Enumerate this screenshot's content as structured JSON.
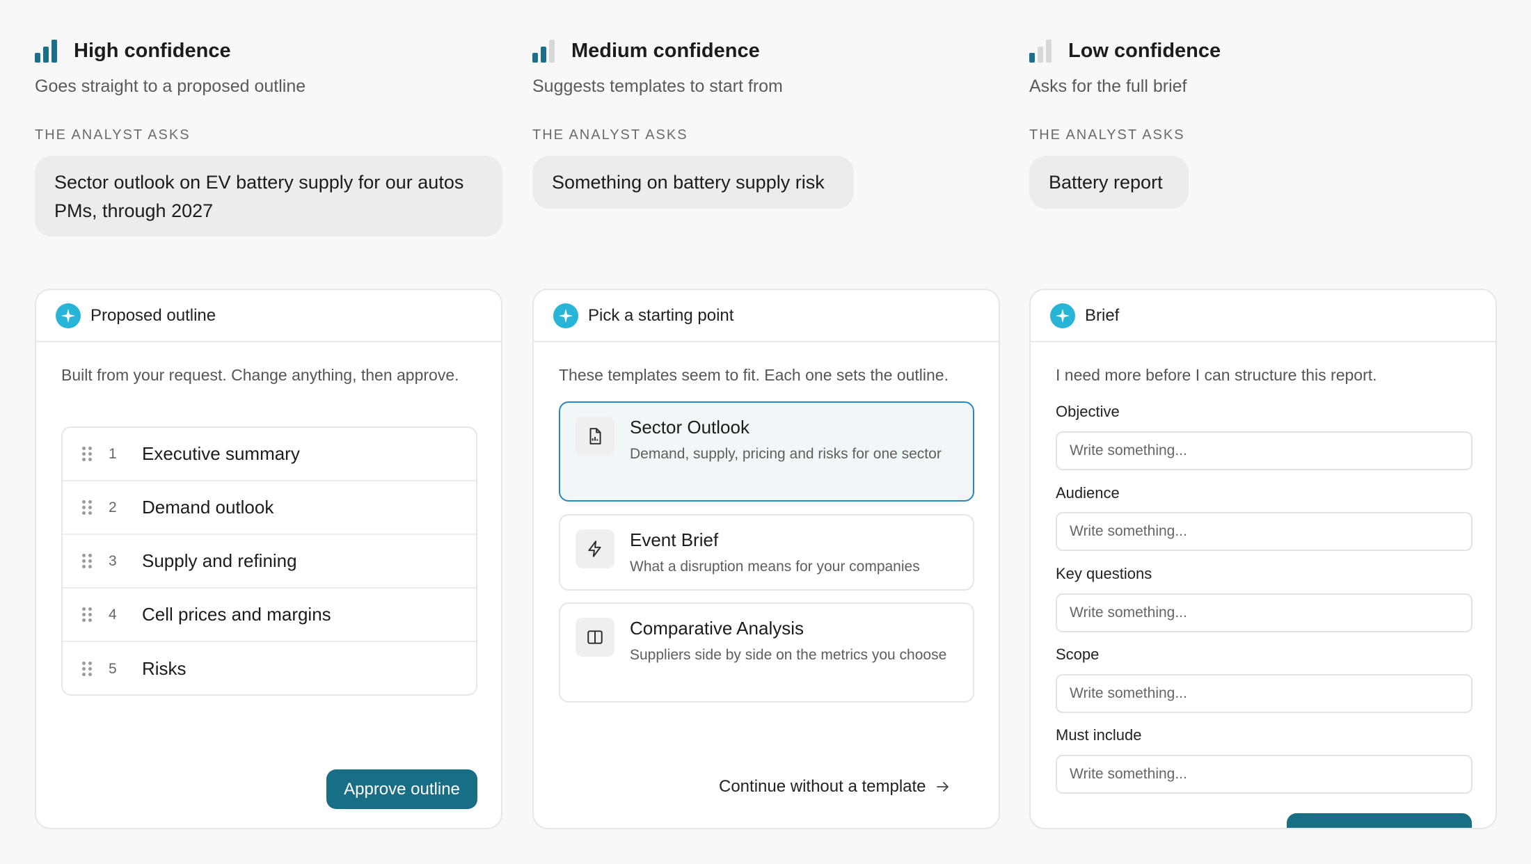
{
  "colors": {
    "accent": "#186f85",
    "bar_on": "#1b6f8a",
    "bar_off": "#d8d8d8",
    "spark": "#27b4d6",
    "selected_border": "#2a86c2"
  },
  "columns": [
    {
      "title": "High confidence",
      "subtitle": "Goes straight to a proposed outline",
      "asks_label": "THE ANALYST ASKS",
      "request": "Sector outlook on EV battery supply for our autos PMs, through 2027",
      "bars_on": 3
    },
    {
      "title": "Medium confidence",
      "subtitle": "Suggests templates to start from",
      "asks_label": "THE ANALYST ASKS",
      "request": "Something on battery supply risk",
      "bars_on": 2
    },
    {
      "title": "Low confidence",
      "subtitle": "Asks for the full brief",
      "asks_label": "THE ANALYST ASKS",
      "request": "Battery report",
      "bars_on": 1
    }
  ],
  "outline_card": {
    "title": "Proposed outline",
    "intro": "Built from your request. Change anything, then approve.",
    "items": [
      {
        "num": "1",
        "label": "Executive summary"
      },
      {
        "num": "2",
        "label": "Demand outlook"
      },
      {
        "num": "3",
        "label": "Supply and refining"
      },
      {
        "num": "4",
        "label": "Cell prices and margins"
      },
      {
        "num": "5",
        "label": "Risks"
      }
    ],
    "approve_label": "Approve outline"
  },
  "template_card": {
    "title": "Pick a starting point",
    "intro": "These templates seem to fit. Each one sets the outline.",
    "templates": [
      {
        "name": "Sector Outlook",
        "desc": "Demand, supply, pricing and risks for one sector",
        "icon": "document-chart-icon",
        "selected": true
      },
      {
        "name": "Event Brief",
        "desc": "What a disruption means for your companies",
        "icon": "lightning-icon",
        "selected": false
      },
      {
        "name": "Comparative Analysis",
        "desc": "Suppliers side by side on the metrics you choose",
        "icon": "columns-icon",
        "selected": false
      }
    ],
    "continue_label": "Continue without a template"
  },
  "brief_card": {
    "title": "Brief",
    "intro": "I need more before I can structure this report.",
    "fields": [
      {
        "label": "Objective",
        "placeholder": "Write something..."
      },
      {
        "label": "Audience",
        "placeholder": "Write something..."
      },
      {
        "label": "Key questions",
        "placeholder": "Write something..."
      },
      {
        "label": "Scope",
        "placeholder": "Write something..."
      },
      {
        "label": "Must include",
        "placeholder": "Write something..."
      }
    ]
  }
}
